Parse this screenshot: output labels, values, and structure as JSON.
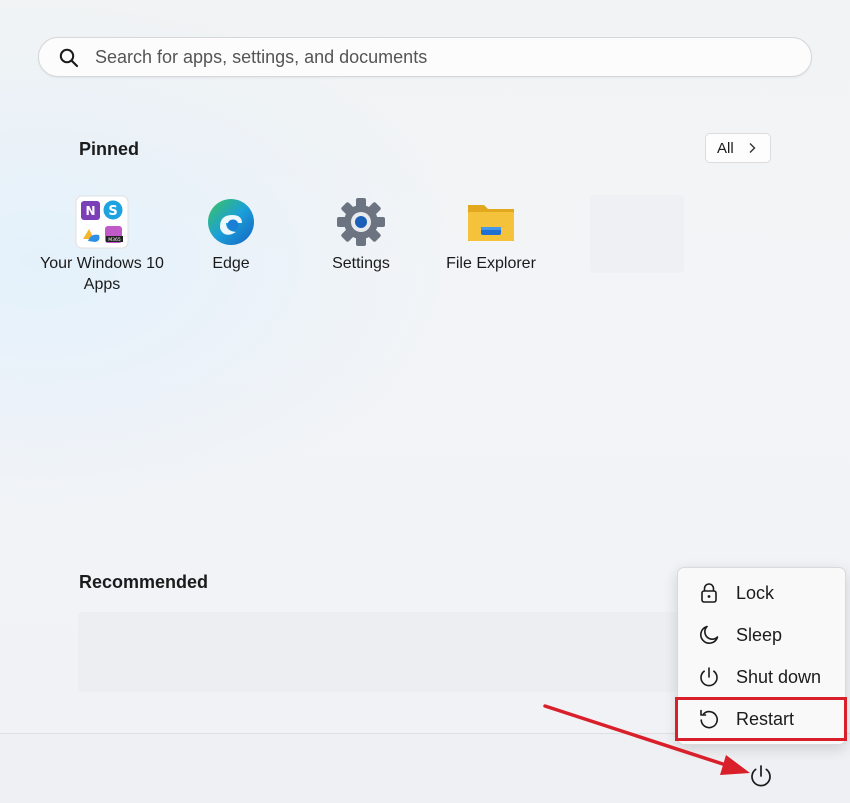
{
  "search": {
    "placeholder": "Search for apps, settings, and documents",
    "icon": "search-icon"
  },
  "pinned": {
    "title": "Pinned",
    "all_label": "All",
    "apps": [
      {
        "label": "Your Windows 10 Apps",
        "icon": "windows-apps-folder-icon"
      },
      {
        "label": "Edge",
        "icon": "edge-icon"
      },
      {
        "label": "Settings",
        "icon": "gear-icon"
      },
      {
        "label": "File Explorer",
        "icon": "folder-icon"
      }
    ]
  },
  "recommended": {
    "title": "Recommended"
  },
  "power_menu": {
    "items": [
      {
        "label": "Lock",
        "icon": "lock-icon"
      },
      {
        "label": "Sleep",
        "icon": "moon-icon"
      },
      {
        "label": "Shut down",
        "icon": "power-icon"
      },
      {
        "label": "Restart",
        "icon": "restart-icon"
      }
    ],
    "highlighted": "Restart"
  },
  "colors": {
    "annotation_red": "#d9202a",
    "edge_blue": "#1b7fd6",
    "edge_green": "#3ec45a",
    "folder_yellow": "#f5c33b",
    "settings_grey": "#6b7480"
  }
}
